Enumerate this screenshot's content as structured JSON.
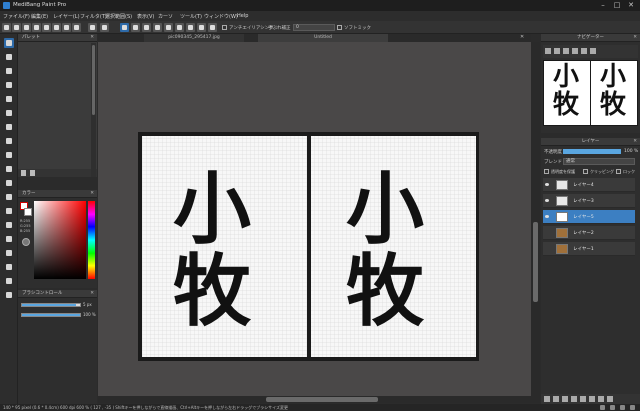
{
  "window": {
    "title": "MediBang Paint Pro",
    "controls": [
      "–",
      "□",
      "✕"
    ]
  },
  "menubar": {
    "items": [
      "ファイル(F)",
      "編集(E)",
      "レイヤー(L)",
      "フィルタ(T)",
      "選択範囲(S)",
      "表示(V)",
      "ウィンドウ(W)",
      "ヘルプ(H)"
    ],
    "short_items": [
      "ファイル(F)",
      "編集(E)",
      "レイヤー(L)",
      "フィルタ(T)",
      "選択範囲(S)",
      "表示(V)",
      "カーソ",
      "ツール(T)",
      "ウィンドウ(W)",
      "Help"
    ]
  },
  "toolbar": {
    "antialias_label": "アンチエイリアシング",
    "correction_label": "手ぶれ補正",
    "correction_value": "0",
    "soft_snap_label": "ソフトミック"
  },
  "palette_panel": {
    "title": "パレット"
  },
  "color_panel": {
    "title": "カラー",
    "hsv_lines": [
      "R:255",
      "G:255",
      "B:255"
    ]
  },
  "brush_control": {
    "title": "ブラシコントロール",
    "size_value": "5 px",
    "opacity_value": "100 %",
    "size_pct": 0.93,
    "opacity_pct": 1.0
  },
  "document": {
    "tabs": [
      "pic090345_295417.jpg",
      "Untitled"
    ],
    "text_lines": [
      "小",
      "牧"
    ]
  },
  "navigator_panel": {
    "title": "ナビゲーター"
  },
  "layer_panel": {
    "title": "レイヤー",
    "opacity_label": "不透明度",
    "opacity_value": "100 %",
    "blend_label": "ブレンド",
    "blend_value": "通常",
    "protect_label": "透明度を保護",
    "clipping_label": "クリッピング",
    "lock_label": "ロック",
    "layers": [
      {
        "name": "レイヤー4",
        "visible": true,
        "selected": false
      },
      {
        "name": "レイヤー3",
        "visible": true,
        "selected": false
      },
      {
        "name": "レイヤー5",
        "visible": true,
        "selected": true
      },
      {
        "name": "レイヤー2",
        "visible": false,
        "selected": false
      },
      {
        "name": "レイヤー1",
        "visible": false,
        "selected": false
      }
    ]
  },
  "status": {
    "text": "140 * 95 pixel  (0.6 * 0.4cm)  600 dpi  600 %  ( 127 , -35 )  Shiftキーを押しながらで直線描画、Ctrl+Altキーを押しながら左右ドラッグでブラシサイズ変更"
  }
}
